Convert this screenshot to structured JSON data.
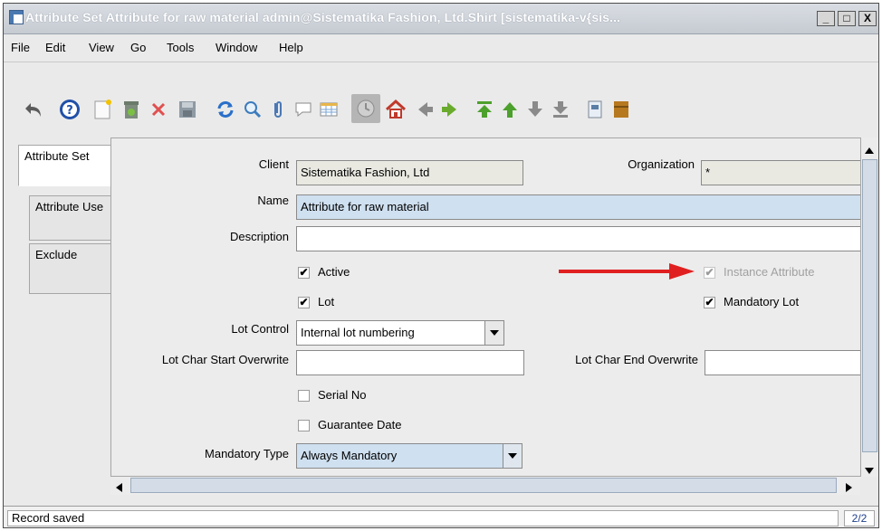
{
  "window": {
    "title": "Attribute Set  Attribute for raw material  admin@Sistematika Fashion, Ltd.Shirt [sistematika-v{sis...",
    "controls": [
      "_",
      "□",
      "X"
    ]
  },
  "menu": {
    "items": [
      {
        "label": "File"
      },
      {
        "label": "Edit"
      },
      {
        "label": "View"
      },
      {
        "label": "Go"
      },
      {
        "label": "Tools"
      },
      {
        "label": "Window"
      },
      {
        "label": "Help"
      }
    ]
  },
  "tabs": [
    {
      "label": "Attribute Set"
    },
    {
      "label": "Attribute Use"
    },
    {
      "label": "Exclude"
    }
  ],
  "form": {
    "client_label": "Client",
    "client_value": "Sistematika Fashion, Ltd",
    "organization_label": "Organization",
    "organization_value": "*",
    "name_label": "Name",
    "name_value": "Attribute for raw material",
    "description_label": "Description",
    "description_value": "",
    "active_label": "Active",
    "instance_attribute_label": "Instance Attribute",
    "lot_label": "Lot",
    "mandatory_lot_label": "Mandatory Lot",
    "lot_control_label": "Lot Control",
    "lot_control_value": "Internal lot numbering",
    "lot_char_start_label": "Lot Char Start Overwrite",
    "lot_char_start_value": "",
    "lot_char_end_label": "Lot Char End Overwrite",
    "lot_char_end_value": "",
    "serial_no_label": "Serial No",
    "guarantee_date_label": "Guarantee Date",
    "mandatory_type_label": "Mandatory Type",
    "mandatory_type_value": "Always Mandatory"
  },
  "checkbox_states": {
    "active": true,
    "instance_attribute": true,
    "lot": true,
    "mandatory_lot": true,
    "serial_no": false,
    "guarantee_date": false
  },
  "status": {
    "message": "Record saved",
    "record_count": "2/2"
  },
  "colors": {
    "mandatory_field": "#cfe0f0",
    "readonly_field": "#e9e9e2",
    "annotation_arrow": "#e02020"
  }
}
